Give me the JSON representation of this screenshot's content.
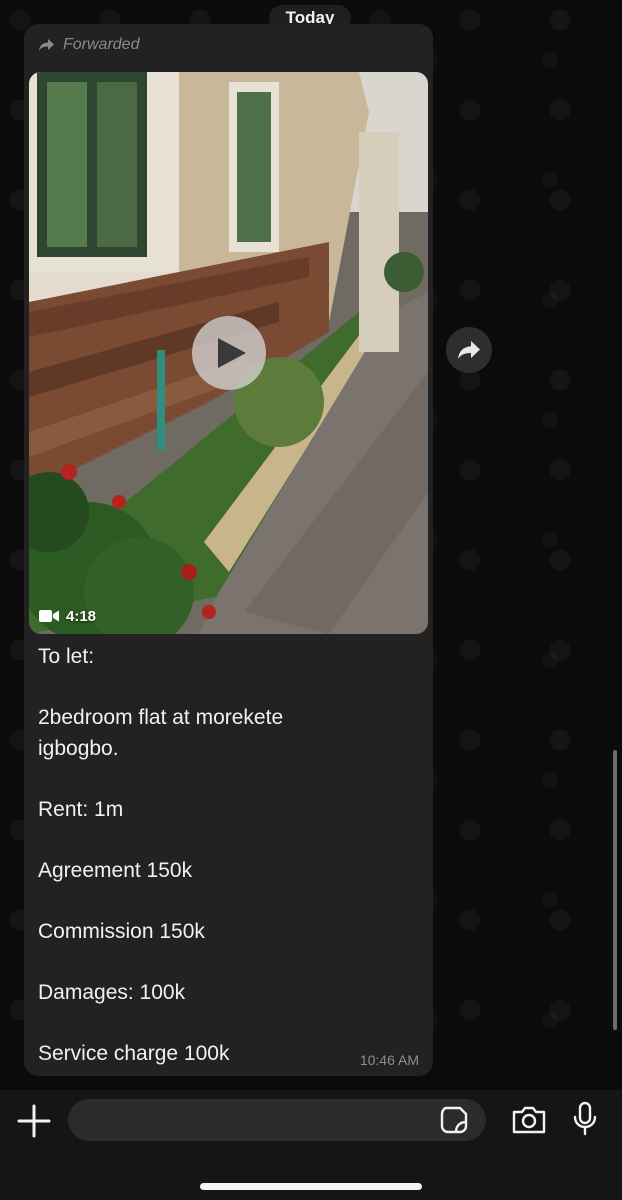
{
  "chat": {
    "date_label": "Today",
    "message": {
      "forwarded_label": "Forwarded",
      "video": {
        "duration": "4:18",
        "play_icon": "play-icon",
        "camera_icon": "video-camera-icon"
      },
      "text_lines": [
        "To let:",
        "",
        "2bedroom flat at morekete",
        "igbogbo.",
        "",
        "Rent: 1m",
        "",
        "Agreement 150k",
        "",
        "Commission 150k",
        "",
        "Damages: 100k",
        "",
        "Service charge 100k"
      ],
      "time": "10:46 AM"
    },
    "forward_button_icon": "forward-arrow-icon"
  },
  "composer": {
    "input_value": "",
    "icons": {
      "attach": "plus-icon",
      "sticker": "sticker-icon",
      "camera": "camera-icon",
      "mic": "microphone-icon"
    }
  },
  "colors": {
    "background": "#0b0b0b",
    "bubble": "#222223",
    "muted_text": "#8b8b8d",
    "composer_bar": "#151516"
  }
}
